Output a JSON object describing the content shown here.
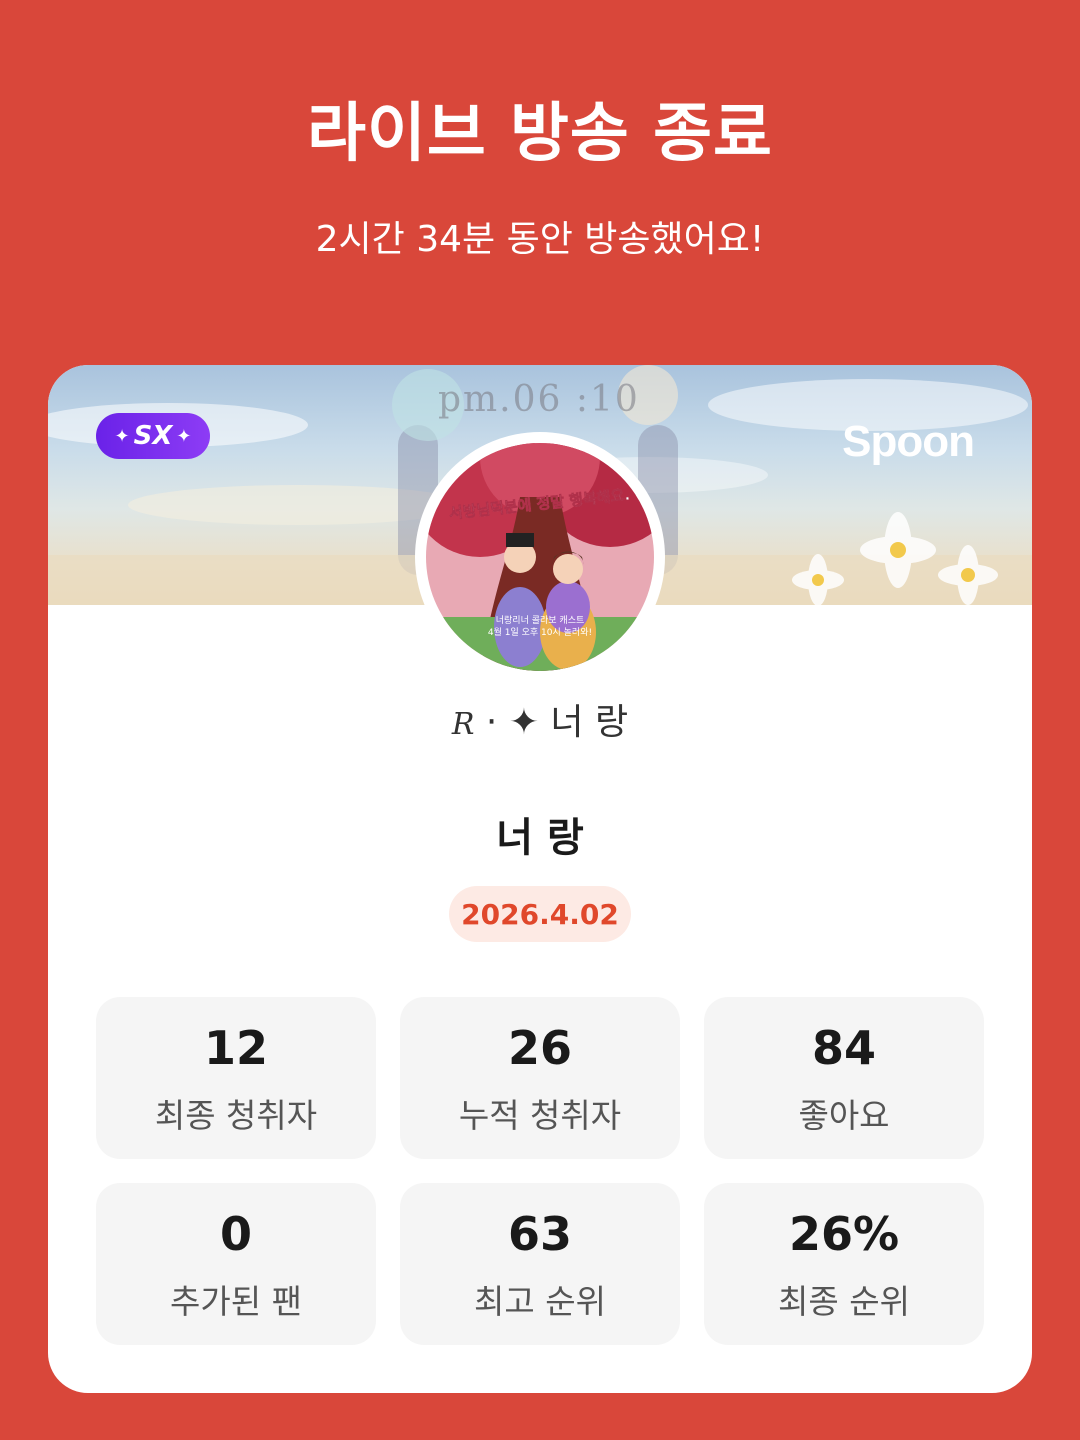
{
  "header": {
    "title": "라이브 방송 종료",
    "subtitle": "2시간 34분 동안 방송했어요!"
  },
  "card": {
    "banner": {
      "badge_label": "SX",
      "brand": "Spoon",
      "art_text": "pm.06 :10"
    },
    "avatar": {
      "caption_top": "서방님덕분에 정말 행복해요.",
      "caption_bottom_1": "너랑리너 콜라보 캐스트",
      "caption_bottom_2": "4월 1일 오후 10시 놀러와!"
    },
    "dj_subname_script": "R",
    "dj_subname_text": "너 랑",
    "dj_name": "너 랑",
    "date": "2026.4.02",
    "stats": [
      {
        "value": "12",
        "label": "최종 청취자"
      },
      {
        "value": "26",
        "label": "누적 청취자"
      },
      {
        "value": "84",
        "label": "좋아요"
      },
      {
        "value": "0",
        "label": "추가된 팬"
      },
      {
        "value": "63",
        "label": "최고 순위"
      },
      {
        "value": "26%",
        "label": "최종 순위"
      }
    ]
  },
  "colors": {
    "background": "#D9473A",
    "date_text": "#E0482B",
    "date_bg": "#FDEAE4",
    "badge": "#7A2EF0"
  }
}
